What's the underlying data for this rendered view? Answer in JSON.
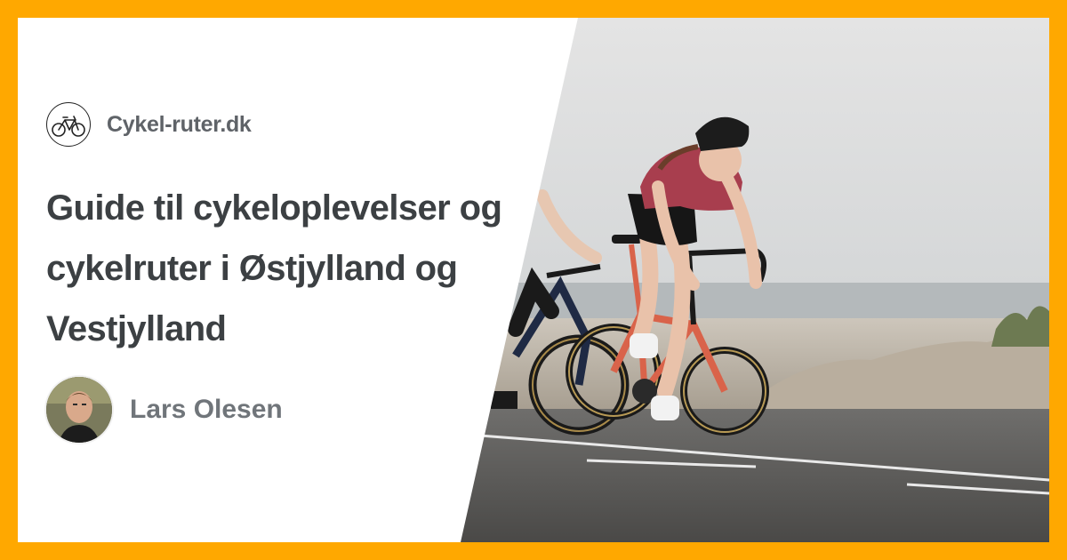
{
  "colors": {
    "frame": "#FFA800",
    "panel": "#FFFFFF",
    "brand_text": "#5F6368",
    "headline_text": "#3C4043",
    "author_text": "#70757A"
  },
  "brand": {
    "logo_icon": "bicycle-icon",
    "name": "Cykel-ruter.dk"
  },
  "article": {
    "title": "Guide til cykeloplevelser og cykelruter i Østjylland og Vestjylland"
  },
  "author": {
    "name": "Lars Olesen",
    "avatar_icon": "author-avatar"
  },
  "hero_image": {
    "subject": "cyclists-on-coastal-road"
  }
}
